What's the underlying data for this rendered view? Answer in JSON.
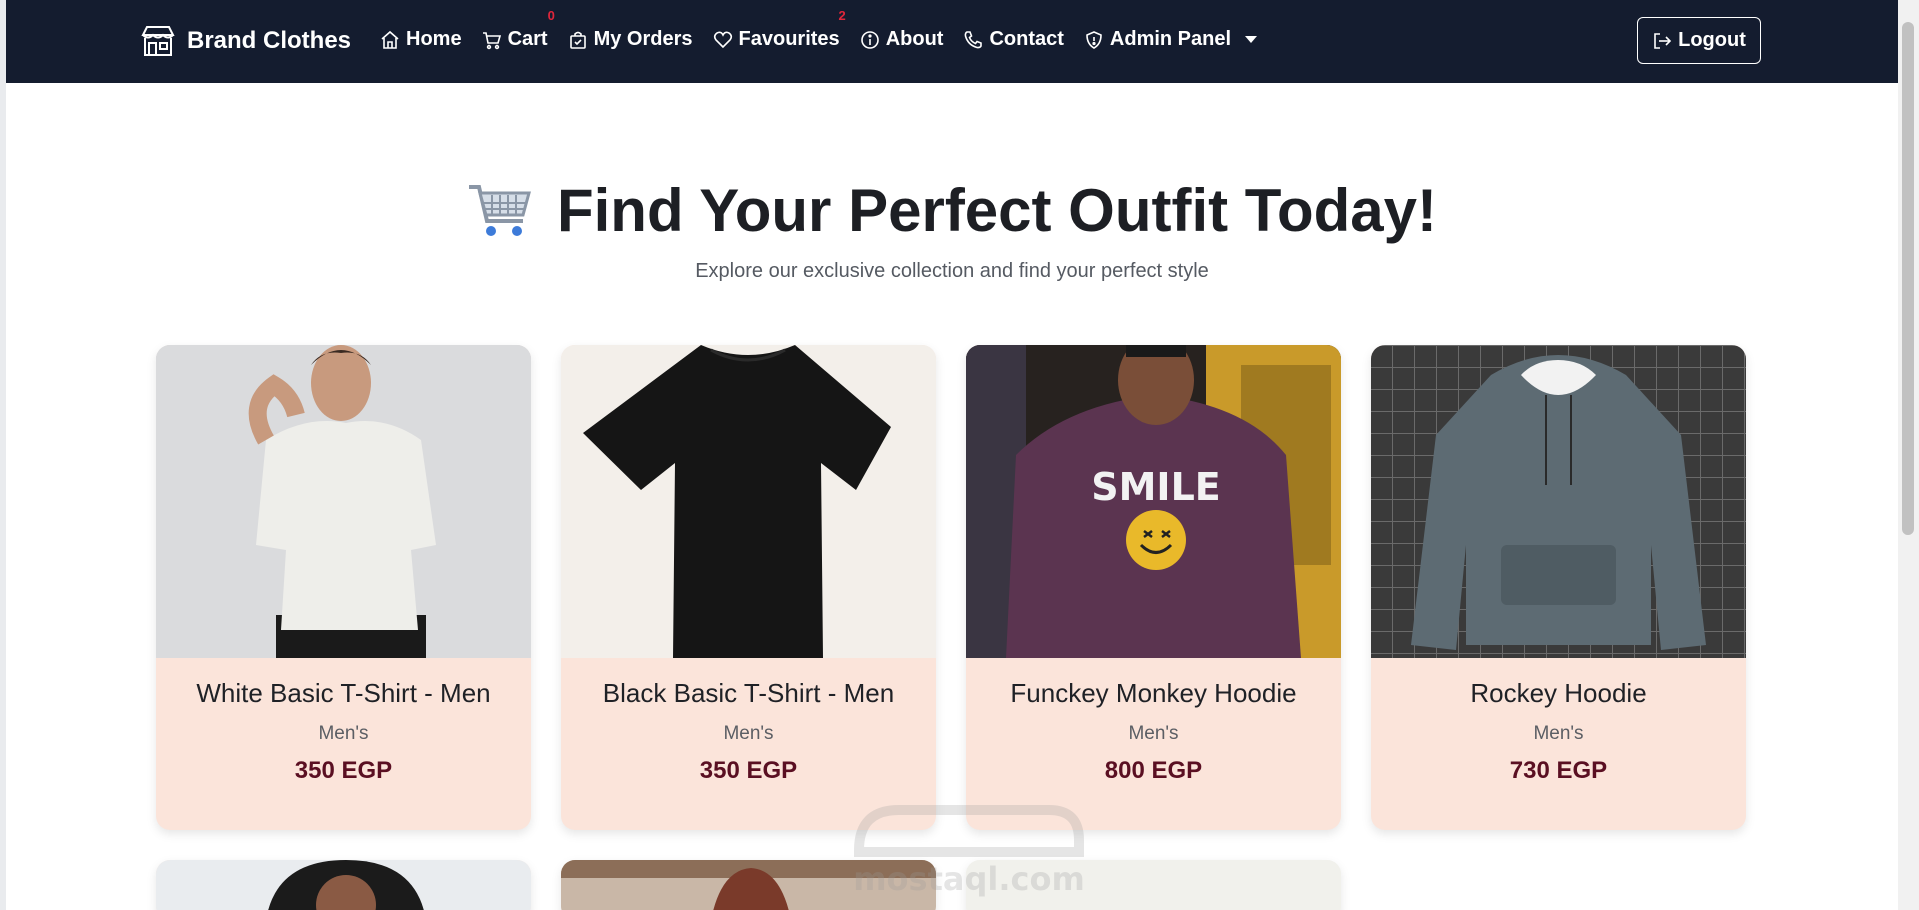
{
  "nav": {
    "brand": "Brand Clothes",
    "items": [
      {
        "label": "Home",
        "icon": "home-icon"
      },
      {
        "label": "Cart",
        "icon": "cart-icon",
        "badge": "0"
      },
      {
        "label": "My Orders",
        "icon": "bag-check-icon"
      },
      {
        "label": "Favourites",
        "icon": "heart-icon",
        "badge": "2"
      },
      {
        "label": "About",
        "icon": "info-icon"
      },
      {
        "label": "Contact",
        "icon": "phone-icon"
      },
      {
        "label": "Admin Panel",
        "icon": "shield-icon"
      }
    ],
    "logout": "Logout"
  },
  "hero": {
    "title": "Find Your Perfect Outfit Today!",
    "subtitle": "Explore our exclusive collection and find your perfect style"
  },
  "products": [
    {
      "name": "White Basic T-Shirt - Men",
      "category": "Men's",
      "price": "350 EGP"
    },
    {
      "name": "Black Basic T-Shirt - Men",
      "category": "Men's",
      "price": "350 EGP"
    },
    {
      "name": "Funckey Monkey Hoodie",
      "category": "Men's",
      "price": "800 EGP"
    },
    {
      "name": "Rockey Hoodie",
      "category": "Men's",
      "price": "730 EGP"
    }
  ],
  "watermark": "mostaql.com",
  "colors": {
    "navbar": "#141c2f",
    "card_bg": "#fbe4da",
    "price": "#5a0f22",
    "badge": "#e0263b"
  }
}
